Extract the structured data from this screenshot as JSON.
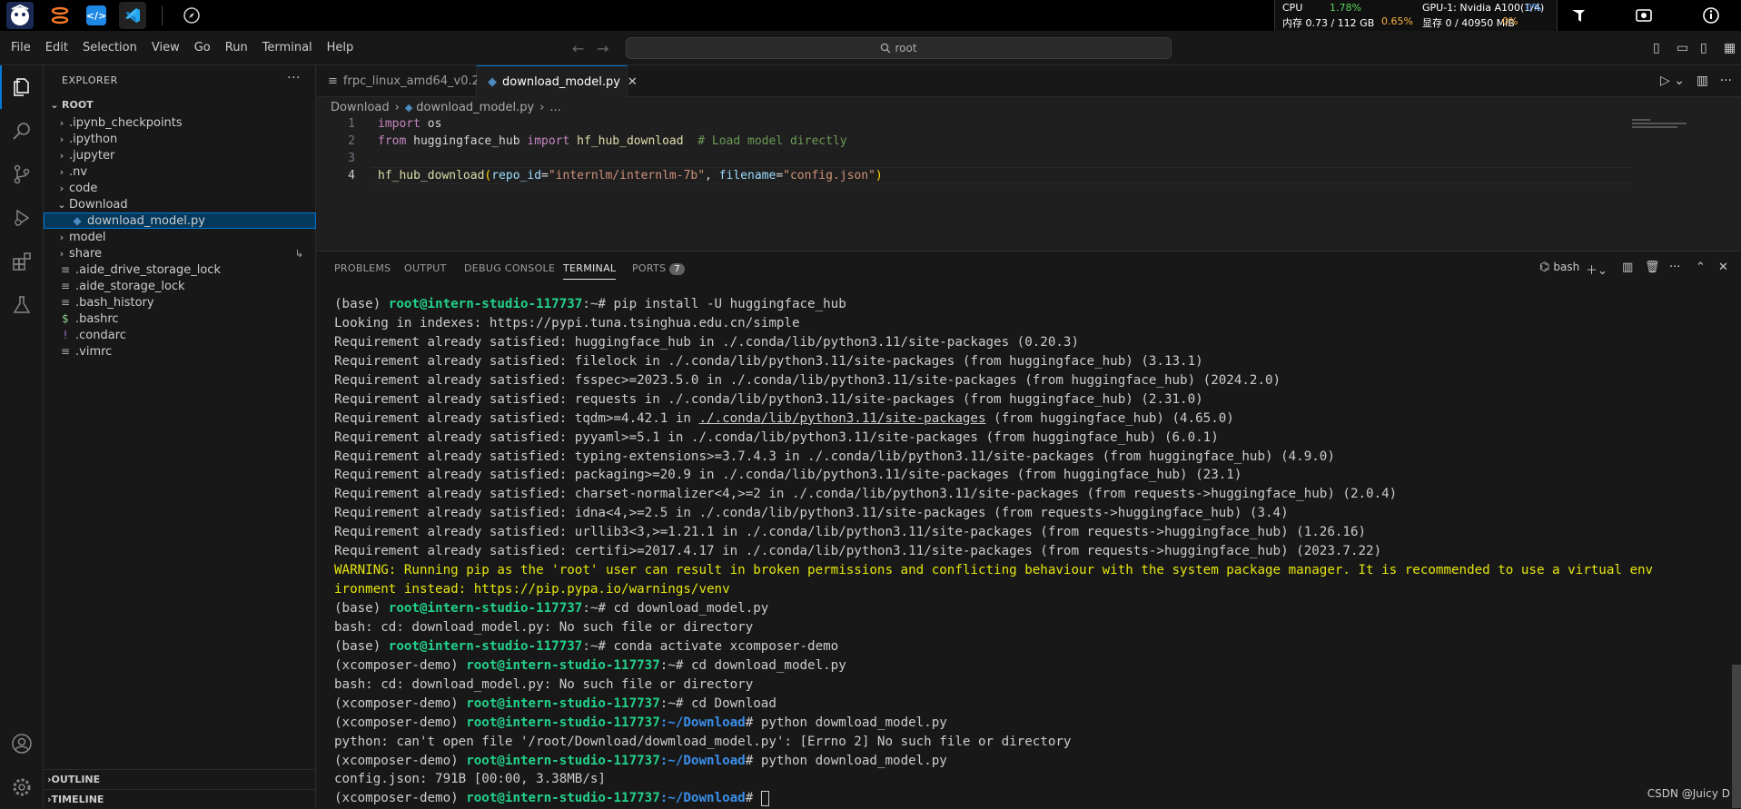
{
  "sysbar": {
    "stats": {
      "cpu_label": "CPU",
      "cpu_pct": "1.78%",
      "mem_label": "内存 0.73 / 112 GB",
      "mem_pct": "0.65%",
      "gpu_label": "GPU-1: Nvidia A100(1/4)",
      "gpu_pct": "0%",
      "vram_label": "显存 0 / 40950 MiB",
      "vram_pct": "0%"
    }
  },
  "menu": {
    "items": [
      "File",
      "Edit",
      "Selection",
      "View",
      "Go",
      "Run",
      "Terminal",
      "Help"
    ],
    "search_text": "root"
  },
  "sidebar": {
    "title": "EXPLORER",
    "root": "ROOT",
    "items": [
      {
        "label": ".ipynb_checkpoints",
        "type": "folder"
      },
      {
        "label": ".ipython",
        "type": "folder"
      },
      {
        "label": ".jupyter",
        "type": "folder"
      },
      {
        "label": ".nv",
        "type": "folder"
      },
      {
        "label": "code",
        "type": "folder"
      },
      {
        "label": "Download",
        "type": "folder-open"
      },
      {
        "label": "download_model.py",
        "type": "python"
      },
      {
        "label": "model",
        "type": "folder"
      },
      {
        "label": "share",
        "type": "folder"
      },
      {
        "label": ".aide_drive_storage_lock",
        "type": "file"
      },
      {
        "label": ".aide_storage_lock",
        "type": "file"
      },
      {
        "label": ".bash_history",
        "type": "file"
      },
      {
        "label": ".bashrc",
        "type": "shell"
      },
      {
        "label": ".condarc",
        "type": "yaml"
      },
      {
        "label": ".vimrc",
        "type": "file"
      }
    ],
    "outline": "OUTLINE",
    "timeline": "TIMELINE"
  },
  "editor": {
    "tabs": [
      {
        "label": "frpc_linux_amd64_v0.2",
        "active": false
      },
      {
        "label": "download_model.py",
        "active": true
      }
    ],
    "breadcrumb": {
      "folder": "Download",
      "file": "download_model.py",
      "tail": "..."
    },
    "line_numbers": [
      "1",
      "2",
      "3",
      "4"
    ],
    "code": {
      "l1_kw": "import",
      "l1_mod": "os",
      "l2_kw1": "from",
      "l2_mod": "huggingface_hub",
      "l2_kw2": "import",
      "l2_fn": "hf_hub_download",
      "l2_comment": "# Load model directly",
      "l4_fn": "hf_hub_download",
      "l4_p1": "repo_id",
      "l4_v1": "\"internlm/internlm-7b\"",
      "l4_p2": "filename",
      "l4_v2": "\"config.json\""
    }
  },
  "panel": {
    "tabs": [
      "PROBLEMS",
      "OUTPUT",
      "DEBUG CONSOLE",
      "TERMINAL",
      "PORTS"
    ],
    "ports_badge": "7",
    "shell": "bash"
  },
  "terminal": {
    "user": "root@intern-studio-117737",
    "lines": [
      "Looking in indexes: https://pypi.tuna.tsinghua.edu.cn/simple",
      "Requirement already satisfied: huggingface_hub in ./.conda/lib/python3.11/site-packages (0.20.3)",
      "Requirement already satisfied: filelock in ./.conda/lib/python3.11/site-packages (from huggingface_hub) (3.13.1)",
      "Requirement already satisfied: fsspec>=2023.5.0 in ./.conda/lib/python3.11/site-packages (from huggingface_hub) (2024.2.0)",
      "Requirement already satisfied: requests in ./.conda/lib/python3.11/site-packages (from huggingface_hub) (2.31.0)",
      "Requirement already satisfied: tqdm>=4.42.1 in",
      "./.conda/lib/python3.11/site-packages",
      " (from huggingface_hub) (4.65.0)",
      "Requirement already satisfied: pyyaml>=5.1 in ./.conda/lib/python3.11/site-packages (from huggingface_hub) (6.0.1)",
      "Requirement already satisfied: typing-extensions>=3.7.4.3 in ./.conda/lib/python3.11/site-packages (from huggingface_hub) (4.9.0)",
      "Requirement already satisfied: packaging>=20.9 in ./.conda/lib/python3.11/site-packages (from huggingface_hub) (23.1)",
      "Requirement already satisfied: charset-normalizer<4,>=2 in ./.conda/lib/python3.11/site-packages (from requests->huggingface_hub) (2.0.4)",
      "Requirement already satisfied: idna<4,>=2.5 in ./.conda/lib/python3.11/site-packages (from requests->huggingface_hub) (3.4)",
      "Requirement already satisfied: urllib3<3,>=1.21.1 in ./.conda/lib/python3.11/site-packages (from requests->huggingface_hub) (1.26.16)",
      "Requirement already satisfied: certifi>=2017.4.17 in ./.conda/lib/python3.11/site-packages (from requests->huggingface_hub) (2023.7.22)",
      "WARNING: Running pip as the 'root' user can result in broken permissions and conflicting behaviour with the system package manager. It is recommended to use a virtual env",
      "ironment instead: https://pip.pypa.io/warnings/venv",
      "bash: cd: download_model.py: No such file or directory",
      "python: can't open file '/root/Download/dowmload_model.py': [Errno 2] No such file or directory",
      "config.json: 791B [00:00, 3.38MB/s]"
    ],
    "prompts": {
      "base": "(base) ",
      "xc": "(xcomposer-demo) ",
      "home": ":~# ",
      "download_path": ":~/Download",
      "hash": "# "
    },
    "commands": [
      "pip install -U huggingface_hub",
      "cd download_model.py",
      "conda activate xcomposer-demo",
      "cd download_model.py",
      "cd Download",
      "python dowmload_model.py",
      "python download_model.py"
    ]
  },
  "watermark": "CSDN @Juicy D",
  "colors": {
    "accent": "#0078d4",
    "prompt_green": "#23d18b",
    "path_blue": "#3b8eea",
    "warning_yellow": "#e5e510"
  }
}
